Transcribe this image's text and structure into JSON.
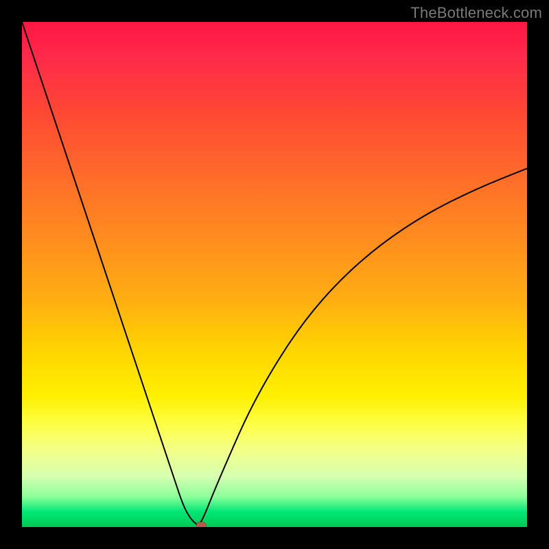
{
  "watermark": "TheBottleneck.com",
  "chart_data": {
    "type": "line",
    "title": "",
    "xlabel": "",
    "ylabel": "",
    "xlim": [
      0,
      100
    ],
    "ylim": [
      0,
      100
    ],
    "grid": false,
    "legend": false,
    "background_gradient": {
      "direction": "vertical",
      "stops": [
        {
          "pos": 0,
          "color": "#ff1744"
        },
        {
          "pos": 18,
          "color": "#ff4834"
        },
        {
          "pos": 42,
          "color": "#ff8a1f"
        },
        {
          "pos": 65,
          "color": "#ffd400"
        },
        {
          "pos": 80,
          "color": "#fdff4a"
        },
        {
          "pos": 90,
          "color": "#d6ffb0"
        },
        {
          "pos": 97,
          "color": "#00e676"
        },
        {
          "pos": 100,
          "color": "#00c853"
        }
      ]
    },
    "series": [
      {
        "name": "left-branch",
        "x": [
          0,
          4,
          8,
          12,
          16,
          20,
          24,
          27,
          30,
          32,
          33.5,
          34.5,
          35
        ],
        "y": [
          100,
          88,
          76,
          64,
          52,
          40,
          28,
          19,
          10,
          4,
          1.5,
          0.6,
          0.3
        ]
      },
      {
        "name": "right-branch",
        "x": [
          35,
          36,
          38,
          41,
          45,
          50,
          56,
          63,
          71,
          80,
          90,
          100
        ],
        "y": [
          0.3,
          2,
          7,
          14,
          23,
          32,
          41,
          49,
          56,
          62,
          67,
          71
        ]
      }
    ],
    "marker": {
      "x": 35.5,
      "y": 0.3,
      "shape": "rounded-rect",
      "color": "#b85a4a"
    }
  }
}
